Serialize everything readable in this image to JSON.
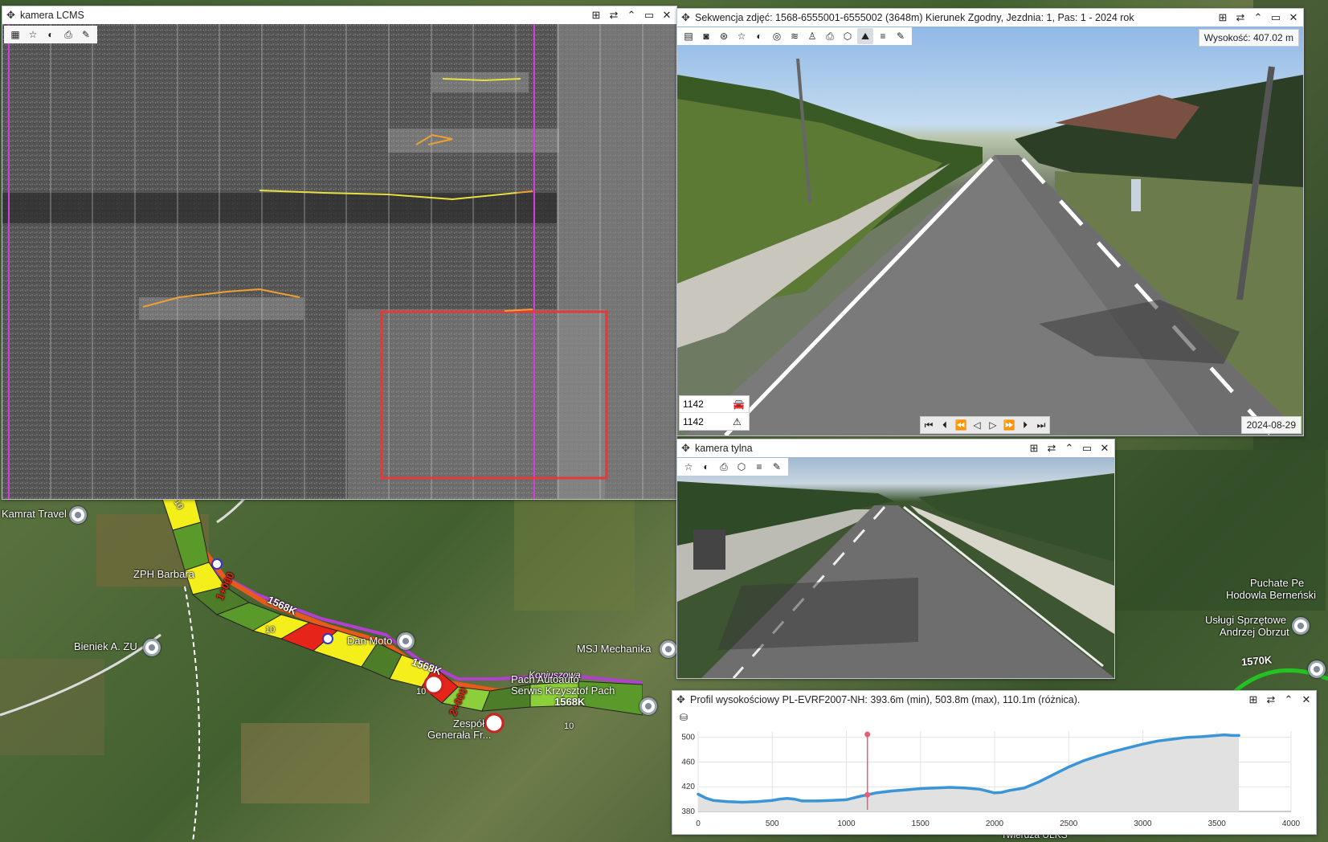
{
  "map": {
    "labels": [
      "Kamrat Travel",
      "ZPH Barbara",
      "Bieniek A. ZU",
      "Dan Moto",
      "MSJ Mechanika",
      "Koniuszowa",
      "Pach Autoauto",
      "Serwis Krzysztof Pach",
      "Zespół",
      "Generała Fr...",
      "Puchate Pe",
      "Hodowla Berneński",
      "Usługi Sprzętowe",
      "Andrzej Obrzut",
      "Twierdza ULKS"
    ],
    "road_labels": [
      "1568K",
      "1568K",
      "1568K",
      "1570K",
      "1+000",
      "2+000",
      "10",
      "10",
      "10",
      "10"
    ]
  },
  "lcms": {
    "title": "kamera LCMS",
    "toolbar": [
      "grid-icon",
      "star-icon",
      "contrast-icon",
      "print-icon",
      "ruler-icon"
    ]
  },
  "front": {
    "title": "Sekwencja zdjęć: 1568-6555001-6555002 (3648m) Kierunek Zgodny, Jezdnia: 1, Pas: 1 - 2024 rok",
    "height_label": "Wysokość: 407.02 m",
    "frame_a": "1142",
    "frame_b": "1142",
    "date": "2024-08-29",
    "playback": [
      "first-icon",
      "prev-frame-icon",
      "rewind-icon",
      "play-back-icon",
      "play-icon",
      "fast-forward-icon",
      "next-frame-icon",
      "last-icon"
    ]
  },
  "rear": {
    "title": "kamera tylna"
  },
  "profile": {
    "title": "Profil wysokościowy PL-EVRF2007-NH: 393.6m (min), 503.8m (max), 110.1m (różnica)."
  },
  "chart_data": {
    "type": "area",
    "title": "",
    "xlabel": "",
    "ylabel": "",
    "xlim": [
      0,
      4000
    ],
    "ylim": [
      380,
      510
    ],
    "x_ticks": [
      0,
      500,
      1000,
      1500,
      2000,
      2500,
      3000,
      3500,
      4000
    ],
    "y_ticks": [
      380,
      420,
      460,
      500
    ],
    "marker_x": 1142,
    "marker_y": 407,
    "series": [
      {
        "color": "#3a95d6",
        "x": [
          0,
          50,
          100,
          200,
          300,
          400,
          500,
          550,
          600,
          650,
          700,
          800,
          900,
          1000,
          1050,
          1100,
          1142,
          1200,
          1300,
          1400,
          1500,
          1600,
          1700,
          1800,
          1900,
          1950,
          2000,
          2050,
          2100,
          2200,
          2300,
          2400,
          2500,
          2600,
          2700,
          2800,
          2900,
          3000,
          3100,
          3200,
          3300,
          3400,
          3500,
          3550,
          3600,
          3648
        ],
        "values": [
          408,
          402,
          398,
          396,
          395,
          396,
          398,
          400,
          401,
          400,
          397,
          397,
          398,
          399,
          402,
          405,
          407,
          410,
          413,
          415,
          417,
          418,
          419,
          418,
          416,
          413,
          410,
          411,
          414,
          418,
          428,
          440,
          452,
          462,
          470,
          477,
          483,
          489,
          494,
          497,
          500,
          501,
          503,
          504,
          503,
          503
        ]
      }
    ]
  },
  "colors": {
    "accent_magenta": "#d63de0",
    "lcms_red_box": "#e43a3a",
    "lcms_yellow": "#e8e040",
    "lcms_orange": "#f0a030",
    "road_yellow": "#f4ef1a",
    "road_red": "#e6241a",
    "road_green": "#5a9a2a",
    "road_lightgreen": "#8ccf3a",
    "road_orange": "#e85a1a",
    "route_purple": "#b13fd0",
    "route_green": "#22c222"
  }
}
